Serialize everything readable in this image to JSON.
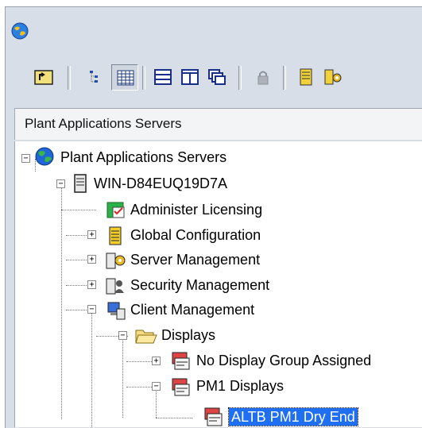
{
  "app": {
    "icon": "globe-icon"
  },
  "toolbar": {
    "buttons": [
      {
        "name": "up-folder-icon"
      },
      {
        "name": "tree-view-icon",
        "pressed": true
      },
      {
        "name": "detail-list-icon",
        "pressed": true
      },
      {
        "name": "horizontal-split-icon"
      },
      {
        "name": "vertical-split-icon"
      },
      {
        "name": "cascade-windows-icon"
      },
      {
        "name": "lock-icon",
        "disabled": true
      },
      {
        "name": "server-icon"
      },
      {
        "name": "server-management-icon"
      }
    ]
  },
  "panel": {
    "title": "Plant Applications Servers"
  },
  "tree": {
    "root": "Plant Applications Servers",
    "server": "WIN-D84EUQ19D7A",
    "items": {
      "licensing": "Administer Licensing",
      "global": "Global Configuration",
      "server_mgmt": "Server Management",
      "security": "Security Management",
      "client": "Client Management",
      "displays": "Displays",
      "no_group": "No Display Group Assigned",
      "pm1": "PM1 Displays",
      "altb": "ALTB PM1 Dry End"
    },
    "colors": {
      "selection": "#1e6ff2"
    }
  }
}
